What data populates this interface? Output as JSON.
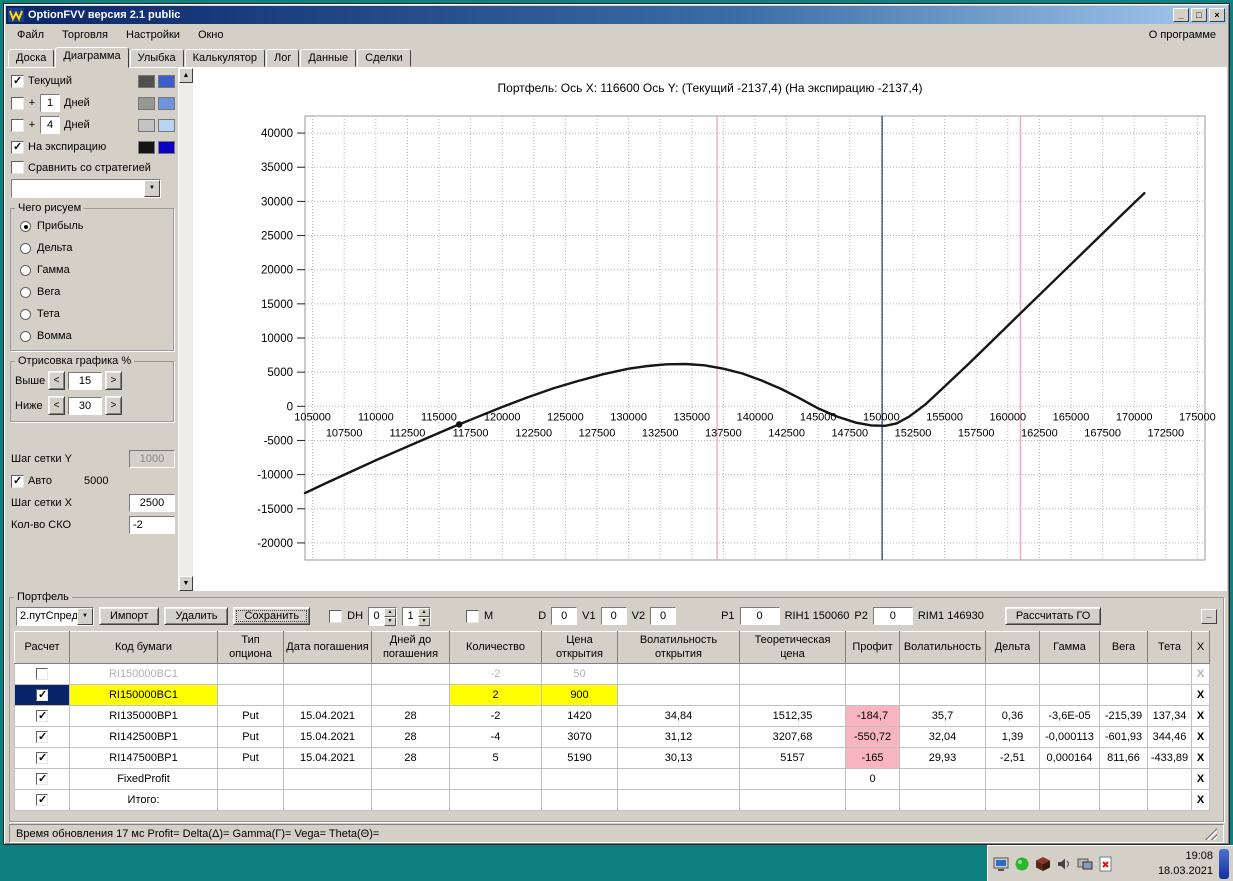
{
  "icons": {
    "dropdown": "▼",
    "up": "▲",
    "down": "▼",
    "scroll_up": "▲",
    "scroll_down": "▼",
    "left": "<",
    "right": ">"
  },
  "window": {
    "title": "OptionFVV версия 2.1 public",
    "menu": [
      "Файл",
      "Торговля",
      "Настройки",
      "Окно"
    ],
    "menu_right": "О программе",
    "tabs": [
      "Доска",
      "Диаграмма",
      "Улыбка",
      "Калькулятор",
      "Лог",
      "Данные",
      "Сделки"
    ],
    "active_tab": "Диаграмма",
    "controls": {
      "minimize": "_",
      "maximize": "□",
      "close": "×"
    }
  },
  "sidebar": {
    "series": [
      {
        "label": "Текущий",
        "checked": true,
        "colors": [
          "#4f4f4f",
          "#3a5fc8"
        ]
      },
      {
        "label": "Дней",
        "prefix": "+",
        "value": "1",
        "checked": false,
        "colors": [
          "#979797",
          "#6e95dc"
        ]
      },
      {
        "label": "Дней",
        "prefix": "+",
        "value": "4",
        "checked": false,
        "colors": [
          "#c3c3c3",
          "#b9d4ef"
        ]
      },
      {
        "label": "На экспирацию",
        "checked": true,
        "colors": [
          "#141414",
          "#0a00c3"
        ]
      }
    ],
    "compare_label": "Сравнить со стратегией",
    "compare_checked": false,
    "strategy_value": "",
    "draw_group": {
      "title": "Чего рисуем",
      "options": [
        "Прибыль",
        "Дельта",
        "Гамма",
        "Вега",
        "Тета",
        "Вомма"
      ],
      "selected": "Прибыль"
    },
    "render_group": {
      "title": "Отрисовка графика %",
      "rows": [
        {
          "label": "Выше",
          "value": "15"
        },
        {
          "label": "Ниже",
          "value": "30"
        }
      ]
    },
    "grid_y_label": "Шаг сетки Y",
    "grid_y_value": "1000",
    "auto_label": "Авто",
    "auto_checked": true,
    "auto_value": "5000",
    "grid_x_label": "Шаг сетки X",
    "grid_x_value": "2500",
    "sko_label": "Кол-во СКО",
    "sko_value": "-2"
  },
  "chart_data": {
    "type": "line",
    "title": "Портфель:  Ось X: 116600  Ось Y:   (Текущий -2137,4)   (На экспирацию -2137,4)",
    "xlim": [
      104400,
      175600
    ],
    "ylim": [
      -22500,
      42500
    ],
    "grid": true,
    "y_ticks": [
      40000,
      35000,
      30000,
      25000,
      20000,
      15000,
      10000,
      5000,
      0,
      -5000,
      -10000,
      -15000,
      -20000
    ],
    "x_ticks_row1": [
      105000,
      110000,
      115000,
      120000,
      125000,
      130000,
      135000,
      140000,
      145000,
      150000,
      155000,
      160000,
      165000,
      170000,
      175000
    ],
    "x_ticks_row2": [
      107500,
      112500,
      117500,
      122500,
      127500,
      132500,
      137500,
      142500,
      147500,
      152500,
      157500,
      162500,
      167500,
      172500
    ],
    "series": [
      {
        "name": "На экспирацию",
        "color": "#161616",
        "x": [
          104400,
          106000,
          108000,
          110000,
          112000,
          114000,
          116000,
          116600,
          118000,
          120000,
          122000,
          124000,
          126000,
          128000,
          130000,
          131500,
          133000,
          134500,
          136000,
          137500,
          139000,
          140500,
          142000,
          143500,
          145000,
          146500,
          148000,
          149200,
          150300,
          151200,
          152200,
          153500,
          155000,
          157000,
          159000,
          161000,
          163000,
          165000,
          167000,
          169000,
          170800
        ],
        "y": [
          -12700,
          -11300,
          -9600,
          -7900,
          -6300,
          -4700,
          -3100,
          -2650,
          -1600,
          -100,
          1300,
          2600,
          3700,
          4700,
          5500,
          5900,
          6150,
          6200,
          6000,
          5500,
          4800,
          3800,
          2600,
          1200,
          -300,
          -1500,
          -2400,
          -2800,
          -2850,
          -2500,
          -1500,
          300,
          2900,
          6400,
          10000,
          13600,
          17200,
          20800,
          24400,
          28000,
          31200
        ]
      }
    ],
    "vlines": [
      {
        "name": "sd-lower-line",
        "x": 137000,
        "color": "#f1a8bd"
      },
      {
        "name": "futures-price-line",
        "x": 150060,
        "color": "#44517c"
      },
      {
        "name": "sd-upper-line",
        "x": 161000,
        "color": "#f1a8bd"
      }
    ],
    "marker": {
      "x": 116600,
      "y": -2650,
      "color": "#111111"
    }
  },
  "portfolio": {
    "group_title": "Портфель",
    "preset_value": "2.путСпред",
    "import_label": "Импорт",
    "delete_label": "Удалить",
    "save_label": "Сохранить",
    "dh_label": "DH",
    "dh_checked": false,
    "dh_spin1": "0",
    "dh_spin2": "1",
    "m_label": "M",
    "m_checked": false,
    "d_label": "D",
    "d_value": "0",
    "v1_label": "V1",
    "v1_value": "0",
    "v2_label": "V2",
    "v2_value": "0",
    "p1_label": "P1",
    "p1_value": "0",
    "rih1_label": "RIH1 150060",
    "p2_label": "P2",
    "p2_value": "0",
    "rim1_label": "RIM1 146930",
    "calc_label": "Рассчитать ГО",
    "collapse_label": "_"
  },
  "table": {
    "headers": [
      "Расчет",
      "Код бумаги",
      "Тип опциона",
      "Дата погашения",
      "Дней до погашения",
      "Количество",
      "Цена открытия",
      "Волатильность открытия",
      "Теоретическая цена",
      "Профит",
      "Волатильность",
      "Дельта",
      "Гамма",
      "Вега",
      "Тета",
      "X"
    ],
    "delete_glyph": "X",
    "rows": [
      {
        "checked": false,
        "dim": true,
        "code": "RI150000BC1",
        "type": "",
        "date": "",
        "days": "",
        "qty": "-2",
        "price": "50",
        "vol_open": "",
        "theo": "",
        "profit": "",
        "vol": "",
        "delta": "",
        "gamma": "",
        "vega": "",
        "theta": ""
      },
      {
        "checked": true,
        "hl": true,
        "sel": true,
        "code": "RI150000BC1",
        "type": "",
        "date": "",
        "days": "",
        "qty": "2",
        "price": "900",
        "vol_open": "",
        "theo": "",
        "profit": "",
        "vol": "",
        "delta": "",
        "gamma": "",
        "vega": "",
        "theta": ""
      },
      {
        "checked": true,
        "code": "RI135000BP1",
        "type": "Put",
        "date": "15.04.2021",
        "days": "28",
        "qty": "-2",
        "price": "1420",
        "vol_open": "34,84",
        "theo": "1512,35",
        "profit": "-184,7",
        "profit_pink": true,
        "vol": "35,7",
        "delta": "0,36",
        "gamma": "-3,6E-05",
        "vega": "-215,39",
        "theta": "137,34"
      },
      {
        "checked": true,
        "code": "RI142500BP1",
        "type": "Put",
        "date": "15.04.2021",
        "days": "28",
        "qty": "-4",
        "price": "3070",
        "vol_open": "31,12",
        "theo": "3207,68",
        "profit": "-550,72",
        "profit_pink": true,
        "vol": "32,04",
        "delta": "1,39",
        "gamma": "-0,000113",
        "vega": "-601,93",
        "theta": "344,46"
      },
      {
        "checked": true,
        "code": "RI147500BP1",
        "type": "Put",
        "date": "15.04.2021",
        "days": "28",
        "qty": "5",
        "price": "5190",
        "vol_open": "30,13",
        "theo": "5157",
        "profit": "-165",
        "profit_pink": true,
        "vol": "29,93",
        "delta": "-2,51",
        "gamma": "0,000164",
        "vega": "811,66",
        "theta": "-433,89"
      },
      {
        "checked": true,
        "code": "FixedProfit",
        "type": "",
        "date": "",
        "days": "",
        "qty": "",
        "price": "",
        "vol_open": "",
        "theo": "",
        "profit": "0",
        "vol": "",
        "delta": "",
        "gamma": "",
        "vega": "",
        "theta": ""
      },
      {
        "checked": true,
        "code": "Итого:",
        "type": "",
        "date": "",
        "days": "",
        "qty": "",
        "price": "",
        "vol_open": "",
        "theo": "",
        "profit": "",
        "vol": "",
        "delta": "",
        "gamma": "",
        "vega": "",
        "theta": ""
      }
    ]
  },
  "statusbar": {
    "text": "Время обновления 17 мс  Profit= Delta(Δ)= Gamma(Γ)= Vega= Theta(Θ)="
  },
  "tray": {
    "icons": [
      "display-icon",
      "antivirus-icon",
      "package-icon",
      "volume-icon",
      "devices-icon",
      "error-icon"
    ],
    "time": "19:08",
    "date": "18.03.2021"
  }
}
